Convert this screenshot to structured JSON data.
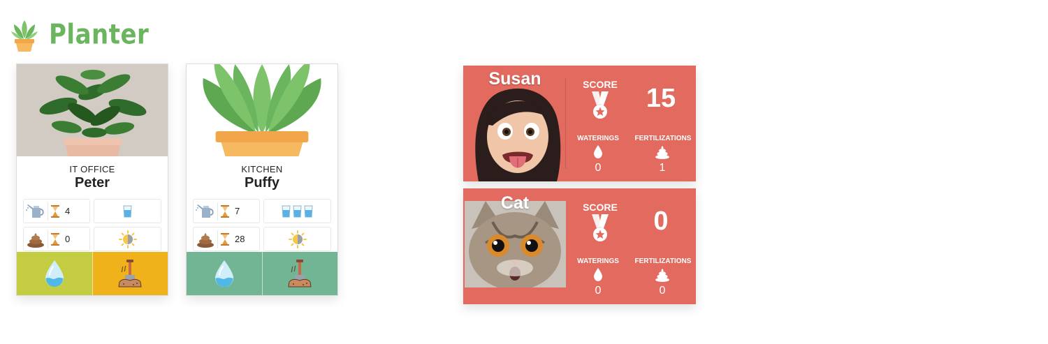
{
  "app": {
    "title": "Planter",
    "logo_icon": "potted-plant-icon"
  },
  "plants": [
    {
      "room": "IT OFFICE",
      "name": "Peter",
      "water_days": "4",
      "water_glasses": 1,
      "fert_days": "0",
      "light": "half-sun",
      "actions": {
        "water_color": "#c4cd41",
        "fert_color": "#efb21b"
      }
    },
    {
      "room": "KITCHEN",
      "name": "Puffy",
      "water_days": "7",
      "water_glasses": 3,
      "fert_days": "28",
      "light": "half-sun",
      "actions": {
        "water_color": "#72b595",
        "fert_color": "#72b595"
      }
    }
  ],
  "users": [
    {
      "name": "Susan",
      "score_label": "SCORE",
      "score": "15",
      "waterings_label": "WATERINGS",
      "waterings": "0",
      "fertilizations_label": "FERTILIZATIONS",
      "fertilizations": "1"
    },
    {
      "name": "Cat",
      "score_label": "SCORE",
      "score": "0",
      "waterings_label": "WATERINGS",
      "waterings": "0",
      "fertilizations_label": "FERTILIZATIONS",
      "fertilizations": "0"
    }
  ],
  "colors": {
    "brand": "#6ab55e",
    "user_card": "#e26a5f"
  }
}
